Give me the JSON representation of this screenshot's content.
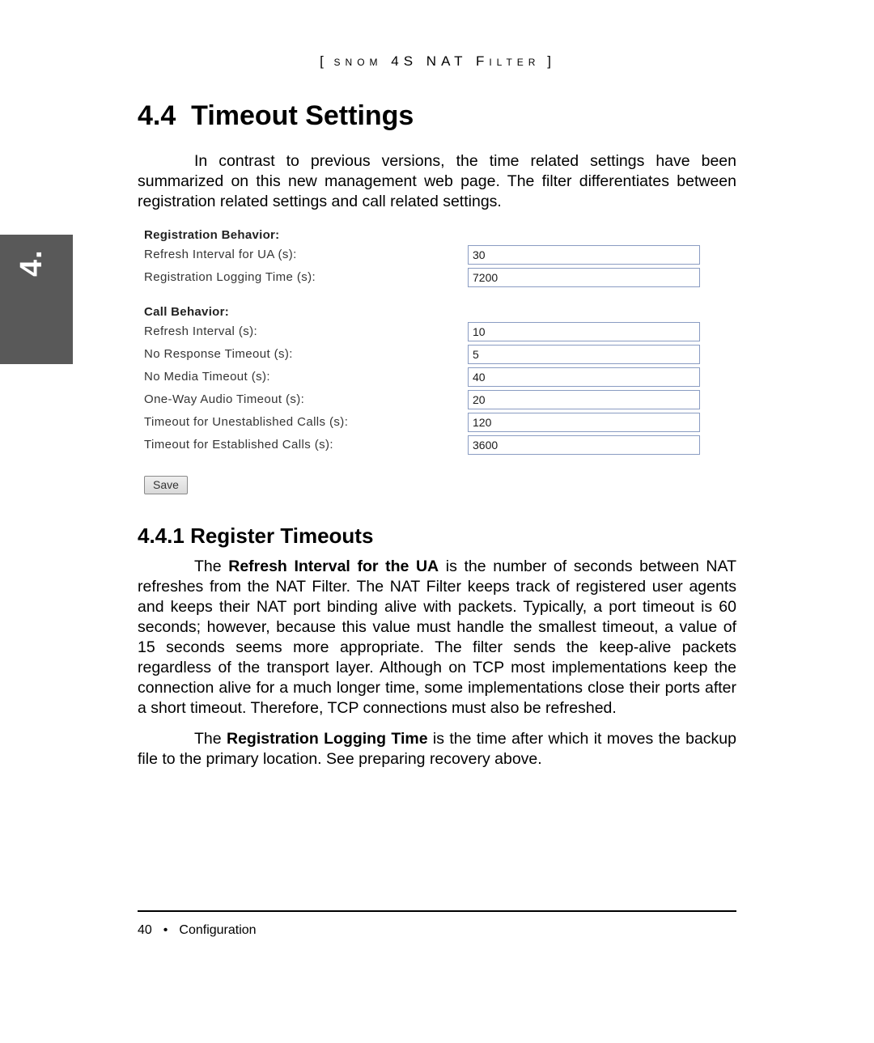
{
  "running_header": {
    "left_bracket": "[",
    "right_bracket": "]",
    "text": "snom 4S NAT Filter"
  },
  "tab_label": "4.",
  "section_number": "4.4",
  "section_title": "Timeout Settings",
  "intro_paragraph": "In contrast to previous versions, the time related settings have been summarized on this new management web page. The filter differentiates between registration related settings and call related settings.",
  "settings": {
    "registration": {
      "title": "Registration Behavior:",
      "fields": [
        {
          "label": "Refresh Interval for UA (s):",
          "value": "30"
        },
        {
          "label": "Registration Logging Time (s):",
          "value": "7200"
        }
      ]
    },
    "call": {
      "title": "Call Behavior:",
      "fields": [
        {
          "label": "Refresh Interval (s):",
          "value": "10"
        },
        {
          "label": "No Response Timeout (s):",
          "value": "5"
        },
        {
          "label": "No Media Timeout (s):",
          "value": "40"
        },
        {
          "label": "One-Way Audio Timeout (s):",
          "value": "20"
        },
        {
          "label": "Timeout for Unestablished Calls (s):",
          "value": "120"
        },
        {
          "label": "Timeout for Established Calls (s):",
          "value": "3600"
        }
      ]
    },
    "save_label": "Save"
  },
  "subsection_number": "4.4.1",
  "subsection_title": "Register Timeouts",
  "para2_lead_strong": "Refresh Interval for the UA",
  "para2_pre": "The ",
  "para2_post": " is the number of seconds between NAT refreshes from the NAT Filter. The NAT Filter keeps track of registered user agents and keeps their NAT port binding alive with packets. Typically, a port timeout is 60 seconds; however, because this value must handle the smallest timeout, a value of 15 seconds seems more appropriate. The filter sends the keep-alive packets regardless of the transport layer. Although on TCP most implementations keep the connection alive for a much longer time, some implementations close their ports after a short timeout. Therefore, TCP connections must also be refreshed.",
  "para3_pre": "The ",
  "para3_strong": "Registration Logging Time",
  "para3_post": " is the time after which it moves the backup file to the primary location. See preparing recovery above.",
  "footer": {
    "page_number": "40",
    "bullet": "•",
    "chapter": "Configuration"
  }
}
